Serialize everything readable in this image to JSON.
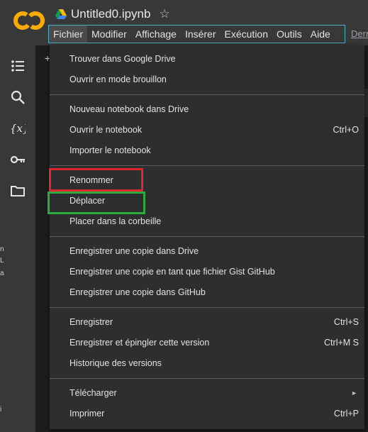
{
  "app": {
    "title": "Untitled0.ipynb",
    "last_edit": "Dern",
    "logo_text": "CO"
  },
  "menubar": {
    "items": [
      "Fichier",
      "Modifier",
      "Affichage",
      "Insérer",
      "Exécution",
      "Outils",
      "Aide"
    ]
  },
  "content": {
    "tab_plus": "+"
  },
  "left_strip": [
    "n",
    "L",
    "a",
    "i"
  ],
  "file_menu": {
    "items": [
      {
        "label": "Trouver dans Google Drive",
        "shortcut": ""
      },
      {
        "label": "Ouvrir en mode brouillon",
        "shortcut": ""
      },
      {
        "label": "Nouveau notebook dans Drive",
        "shortcut": ""
      },
      {
        "label": "Ouvrir le notebook",
        "shortcut": "Ctrl+O"
      },
      {
        "label": "Importer le notebook",
        "shortcut": ""
      },
      {
        "label": "Renommer",
        "shortcut": ""
      },
      {
        "label": "Déplacer",
        "shortcut": ""
      },
      {
        "label": "Placer dans la corbeille",
        "shortcut": ""
      },
      {
        "label": "Enregistrer une copie dans Drive",
        "shortcut": ""
      },
      {
        "label": "Enregistrer une copie en tant que fichier Gist GitHub",
        "shortcut": ""
      },
      {
        "label": "Enregistrer une copie dans GitHub",
        "shortcut": ""
      },
      {
        "label": "Enregistrer",
        "shortcut": "Ctrl+S"
      },
      {
        "label": "Enregistrer et épingler cette version",
        "shortcut": "Ctrl+M S"
      },
      {
        "label": "Historique des versions",
        "shortcut": ""
      },
      {
        "label": "Télécharger",
        "shortcut": "",
        "submenu_arrow": "►"
      },
      {
        "label": "Imprimer",
        "shortcut": "Ctrl+P"
      }
    ]
  },
  "sidebar_icons": [
    "toc-icon",
    "search-icon",
    "variables-icon",
    "key-icon",
    "folder-icon"
  ],
  "colors": {
    "highlight_red": "#e0262f",
    "highlight_green": "#2faa3f",
    "menubar_border": "#4fb3c7",
    "logo_orange": "#f9ab00"
  }
}
